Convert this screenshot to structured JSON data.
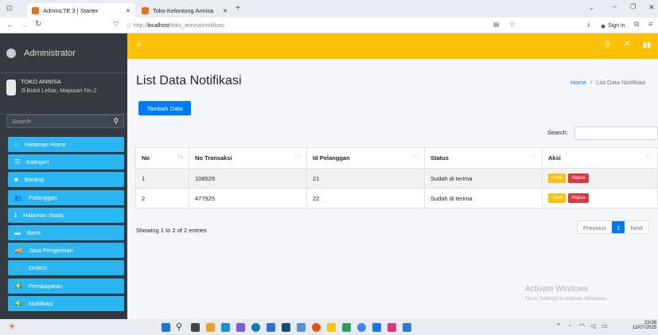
{
  "browser": {
    "tab1": "AdminLTE 3 | Starter",
    "tab2": "Toko Kelontong Annisa",
    "url_prefix": "http://",
    "url_host": "localhost",
    "url_path": "/toko_annisa/notifikasi",
    "sign_in": "Sign in"
  },
  "brand": {
    "title": "Administrator"
  },
  "user": {
    "name": "TOKO ANNISA",
    "address": "Jl.Bukit Lebar, Majasari No.2"
  },
  "search": {
    "placeholder": "Search"
  },
  "sidebar": {
    "items": [
      {
        "label": "Halaman Home",
        "icon": "home-icon",
        "glyph": "⌂"
      },
      {
        "label": "Kategori",
        "icon": "list-icon",
        "glyph": "☰"
      },
      {
        "label": "Barang",
        "icon": "box-icon",
        "glyph": "■"
      },
      {
        "label": "Pelanggan",
        "icon": "users-icon",
        "glyph": "👥"
      },
      {
        "label": "Halaman Statis",
        "icon": "info-icon",
        "glyph": "ℹ"
      },
      {
        "label": "Bank",
        "icon": "bank-icon",
        "glyph": "▬"
      },
      {
        "label": "Jasa Pengiriman",
        "icon": "truck-icon",
        "glyph": "🚚"
      },
      {
        "label": "Orders",
        "icon": "cart-icon",
        "glyph": "🛒"
      },
      {
        "label": "Pembayaran",
        "icon": "money-icon",
        "glyph": "💵"
      },
      {
        "label": "Notifikasi",
        "icon": "money-icon",
        "glyph": "💵"
      }
    ]
  },
  "page": {
    "title": "List Data Notifikasi",
    "breadcrumb_home": "Home",
    "breadcrumb_sep": "/",
    "breadcrumb_current": "List Data Notifikasi"
  },
  "toolbar": {
    "add_label": "Tambah Data"
  },
  "table": {
    "search_label": "Search:",
    "columns": [
      "No",
      "No Transaksi",
      "Id Pelanggan",
      "Status",
      "Aksi"
    ],
    "rows": [
      {
        "no": "1",
        "trx": "108529",
        "id": "21",
        "status": "Sudah di terima"
      },
      {
        "no": "2",
        "trx": "477925",
        "id": "22",
        "status": "Sudah di terima"
      }
    ],
    "edit_label": "Ubah",
    "delete_label": "Hapus",
    "info": "Showing 1 to 2 of 2 entries",
    "prev": "Previous",
    "page": "1",
    "next": "Next"
  },
  "watermark": {
    "line1": "Activate Windows",
    "line2": "Go to Settings to activate Windows."
  },
  "taskbar": {
    "time": "23:08",
    "date": "12/07/2025"
  },
  "colors": {
    "sidebar_bg": "#343a40",
    "nav_item": "#2ab6f2",
    "topbar": "#ffc107",
    "primary": "#007bff",
    "edit": "#ffc107",
    "delete": "#dc3545"
  }
}
